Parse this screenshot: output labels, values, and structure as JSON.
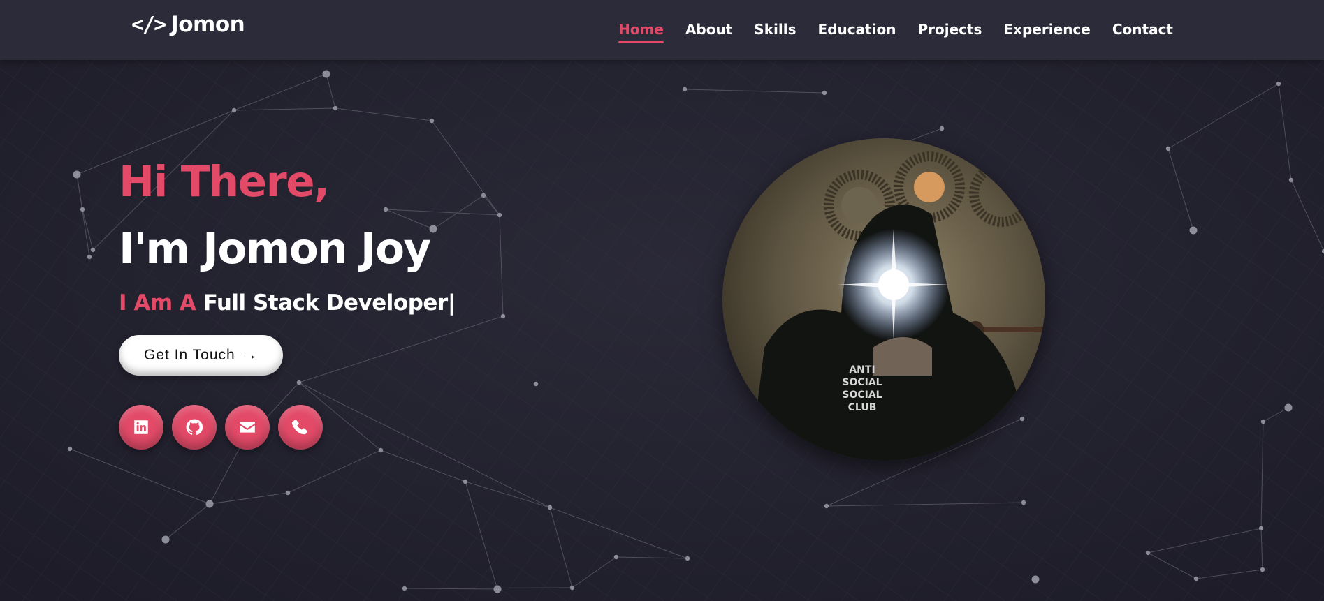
{
  "brand": {
    "icon": "</>",
    "name": "Jomon"
  },
  "nav": {
    "items": [
      {
        "label": "Home",
        "active": true
      },
      {
        "label": "About"
      },
      {
        "label": "Skills"
      },
      {
        "label": "Education"
      },
      {
        "label": "Projects"
      },
      {
        "label": "Experience"
      },
      {
        "label": "Contact"
      }
    ]
  },
  "hero": {
    "greeting": "Hi There,",
    "name": "I'm Jomon Joy",
    "role_prefix": "I Am A",
    "role": "Full Stack Developer|",
    "cta_label": "Get In Touch",
    "cta_icon": "→",
    "socials": [
      {
        "icon": "linkedin-icon"
      },
      {
        "icon": "github-icon"
      },
      {
        "icon": "envelope-icon"
      },
      {
        "icon": "phone-icon"
      }
    ],
    "photo_text": [
      "ANTI",
      "SOCIAL",
      "SOCIAL",
      "CLUB"
    ]
  },
  "colors": {
    "accent": "#e24a68",
    "background": "#23222f",
    "nav_bg": "#2b2b3a",
    "text": "#ffffff"
  }
}
